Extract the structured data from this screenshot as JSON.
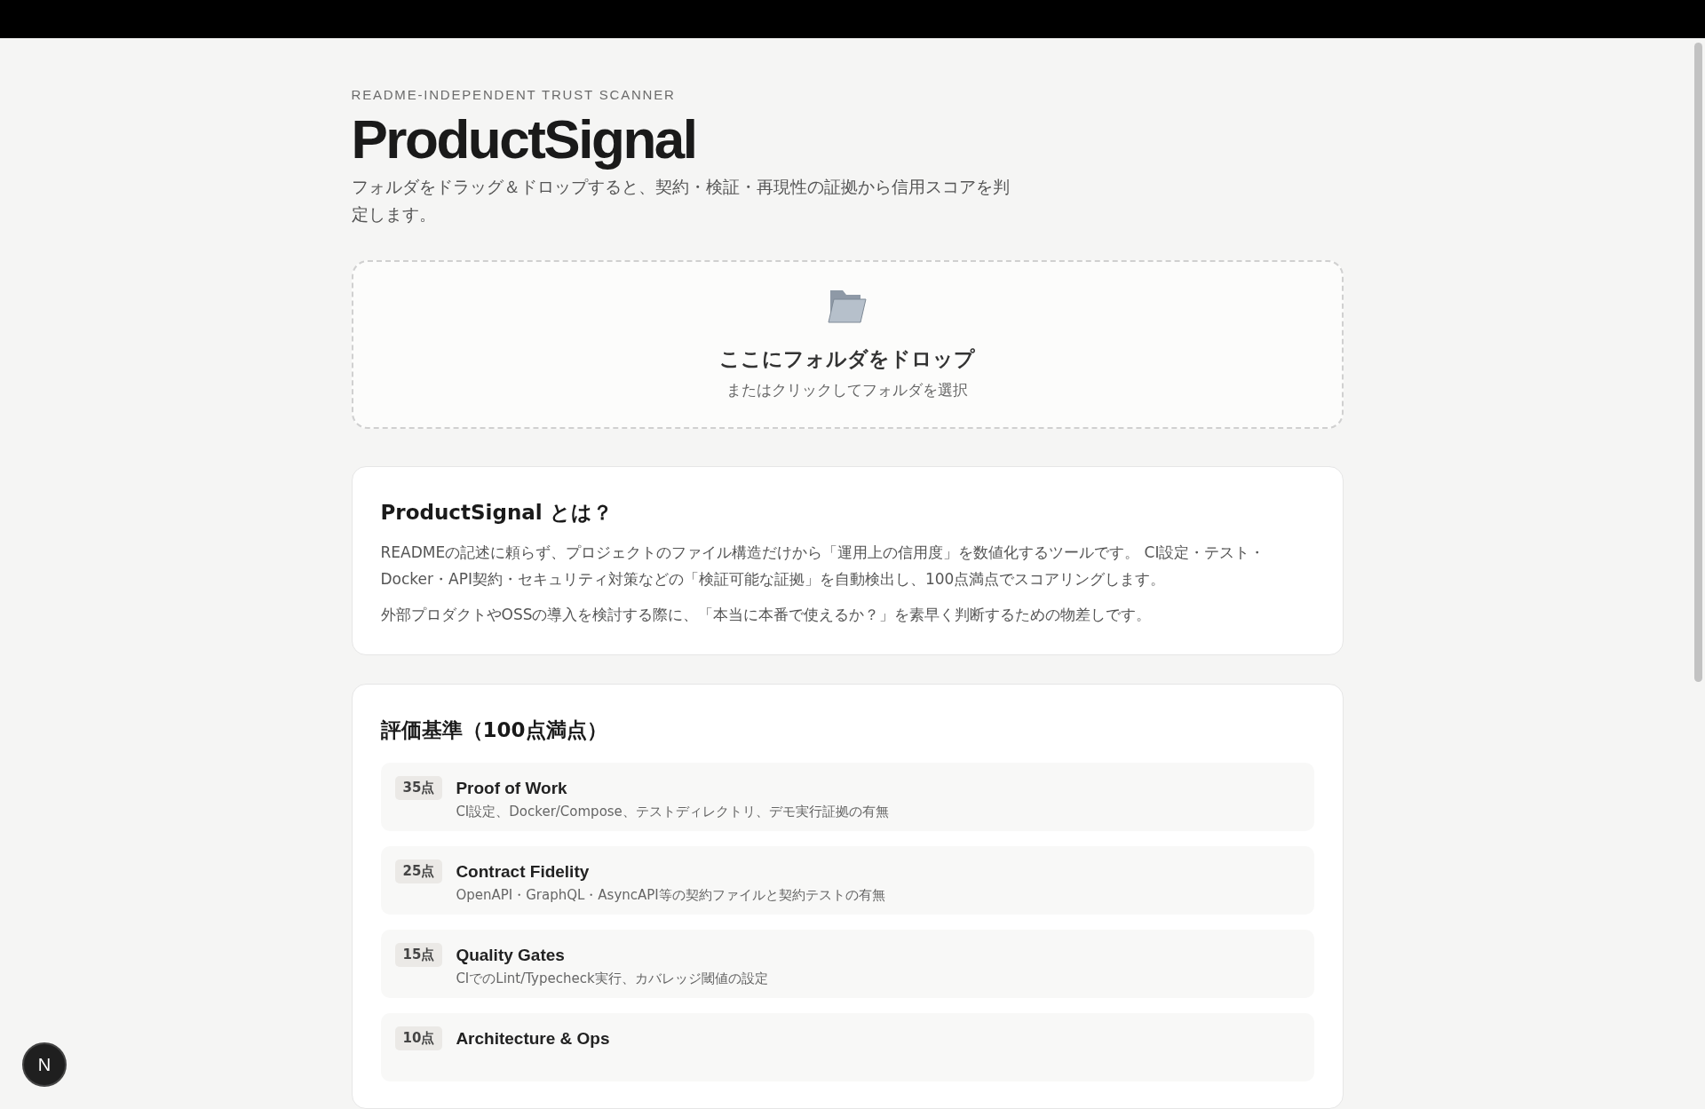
{
  "header": {
    "eyebrow": "README-INDEPENDENT TRUST SCANNER",
    "title": "ProductSignal",
    "description": "フォルダをドラッグ＆ドロップすると、契約・検証・再現性の証拠から信用スコアを判定します。"
  },
  "dropzone": {
    "title": "ここにフォルダをドロップ",
    "subtitle": "またはクリックしてフォルダを選択"
  },
  "about": {
    "title": "ProductSignal とは？",
    "paragraphs": [
      "READMEの記述に頼らず、プロジェクトのファイル構造だけから「運用上の信用度」を数値化するツールです。 CI設定・テスト・Docker・API契約・セキュリティ対策などの「検証可能な証拠」を自動検出し、100点満点でスコアリングします。",
      "外部プロダクトやOSSの導入を検討する際に、「本当に本番で使えるか？」を素早く判断するための物差しです。"
    ]
  },
  "criteria": {
    "title": "評価基準（100点満点）",
    "items": [
      {
        "points": "35点",
        "name": "Proof of Work",
        "detail": "CI設定、Docker/Compose、テストディレクトリ、デモ実行証拠の有無"
      },
      {
        "points": "25点",
        "name": "Contract Fidelity",
        "detail": "OpenAPI・GraphQL・AsyncAPI等の契約ファイルと契約テストの有無"
      },
      {
        "points": "15点",
        "name": "Quality Gates",
        "detail": "CIでのLint/Typecheck実行、カバレッジ閾値の設定"
      },
      {
        "points": "10点",
        "name": "Architecture & Ops"
      }
    ]
  },
  "dev_badge": {
    "label": "N"
  }
}
